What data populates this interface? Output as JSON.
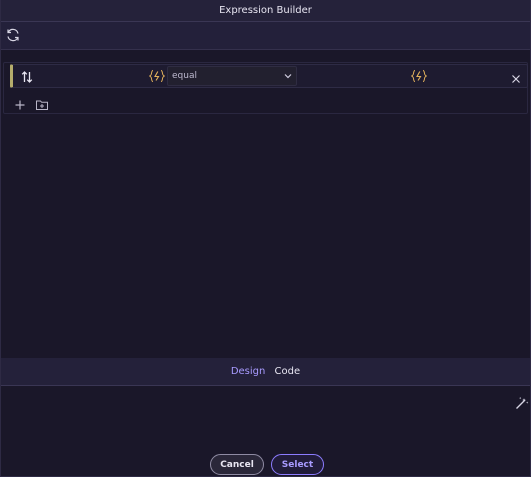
{
  "window": {
    "title": "Expression Builder"
  },
  "toolbar": {
    "refresh_icon": "refresh-icon"
  },
  "condition": {
    "left_icon": "sort-arrows-icon",
    "operator": "equal",
    "fx_icon": "function-icon",
    "accent_color": "#b5ad6c"
  },
  "tabs": [
    {
      "label": "Design",
      "active": true
    },
    {
      "label": "Code",
      "active": false
    }
  ],
  "footer": {
    "cancel_label": "Cancel",
    "select_label": "Select"
  },
  "colors": {
    "accent": "#a89bff",
    "background": "#1a1729"
  }
}
